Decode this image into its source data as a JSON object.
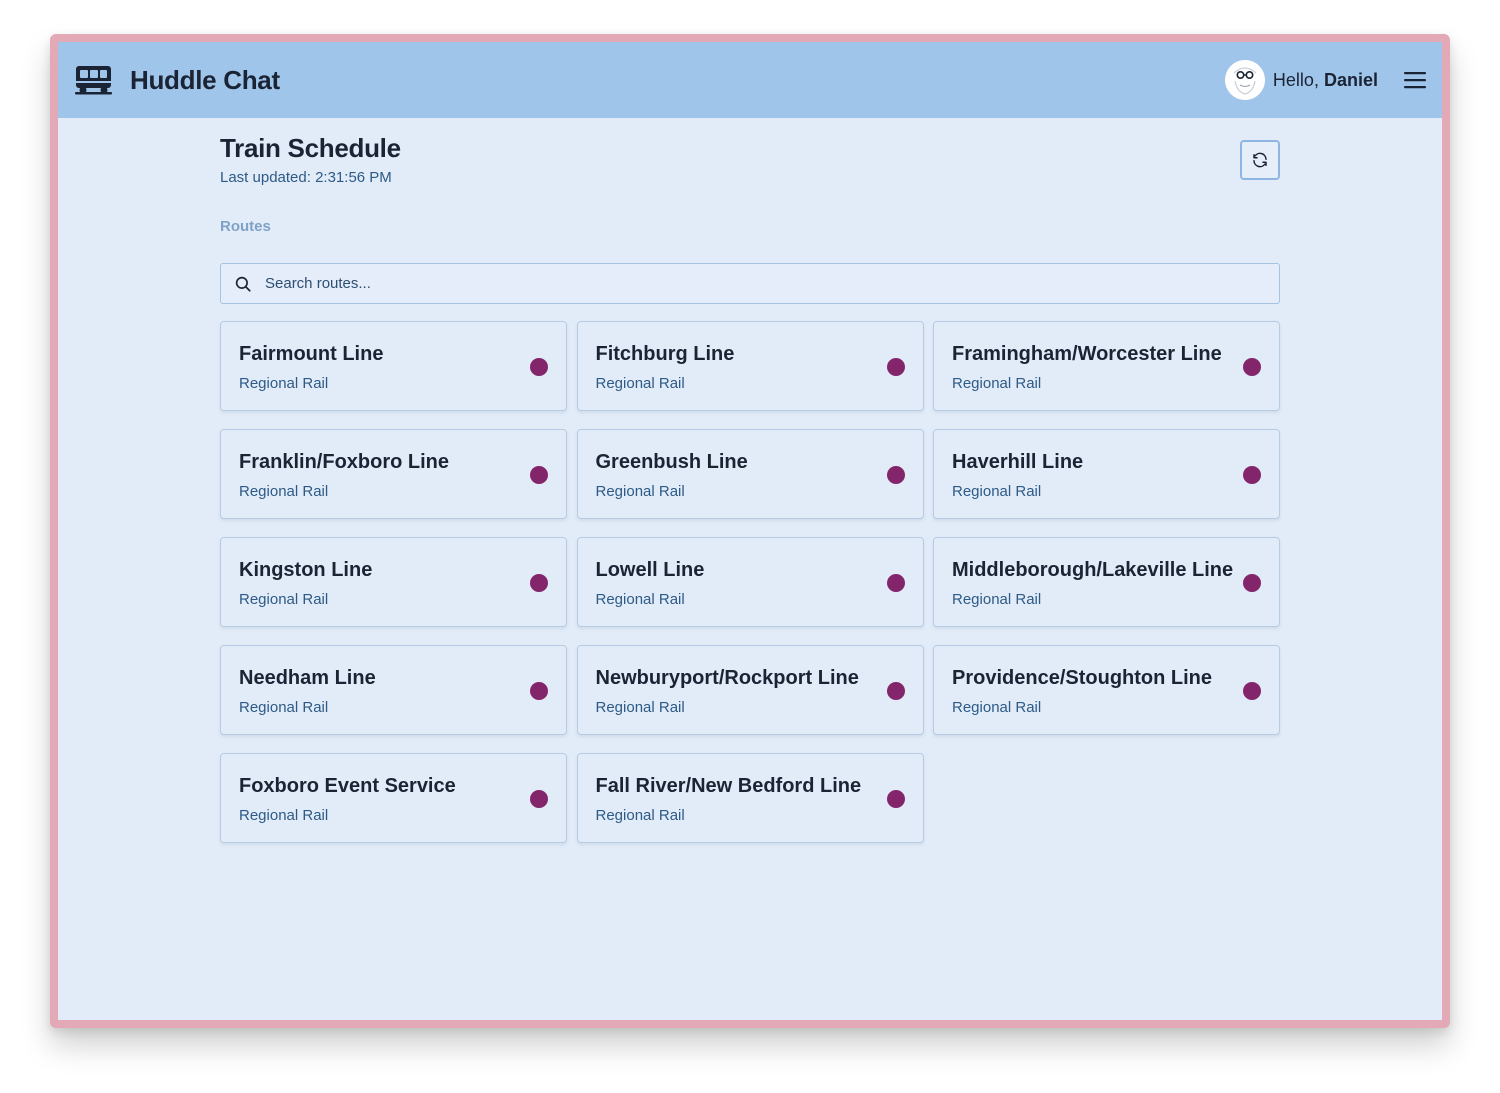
{
  "app": {
    "title": "Huddle Chat",
    "brand_icon": "bus-icon"
  },
  "user": {
    "greeting": "Hello,",
    "name": "Daniel",
    "avatar_icon": "avatar-face"
  },
  "page": {
    "title": "Train Schedule",
    "last_updated": "Last updated: 2:31:56 PM",
    "section_label": "Routes",
    "refresh_icon": "refresh-icon"
  },
  "search": {
    "placeholder": "Search routes..."
  },
  "colors": {
    "navbar": "#a0c5ea",
    "background": "#e2ecf8",
    "status_dot": "#83256b"
  },
  "routes": [
    {
      "name": "Fairmount Line",
      "type": "Regional Rail"
    },
    {
      "name": "Fitchburg Line",
      "type": "Regional Rail"
    },
    {
      "name": "Framingham/Worcester Line",
      "type": "Regional Rail"
    },
    {
      "name": "Franklin/Foxboro Line",
      "type": "Regional Rail"
    },
    {
      "name": "Greenbush Line",
      "type": "Regional Rail"
    },
    {
      "name": "Haverhill Line",
      "type": "Regional Rail"
    },
    {
      "name": "Kingston Line",
      "type": "Regional Rail"
    },
    {
      "name": "Lowell Line",
      "type": "Regional Rail"
    },
    {
      "name": "Middleborough/Lakeville Line",
      "type": "Regional Rail"
    },
    {
      "name": "Needham Line",
      "type": "Regional Rail"
    },
    {
      "name": "Newburyport/Rockport Line",
      "type": "Regional Rail"
    },
    {
      "name": "Providence/Stoughton Line",
      "type": "Regional Rail"
    },
    {
      "name": "Foxboro Event Service",
      "type": "Regional Rail"
    },
    {
      "name": "Fall River/New Bedford Line",
      "type": "Regional Rail"
    }
  ]
}
